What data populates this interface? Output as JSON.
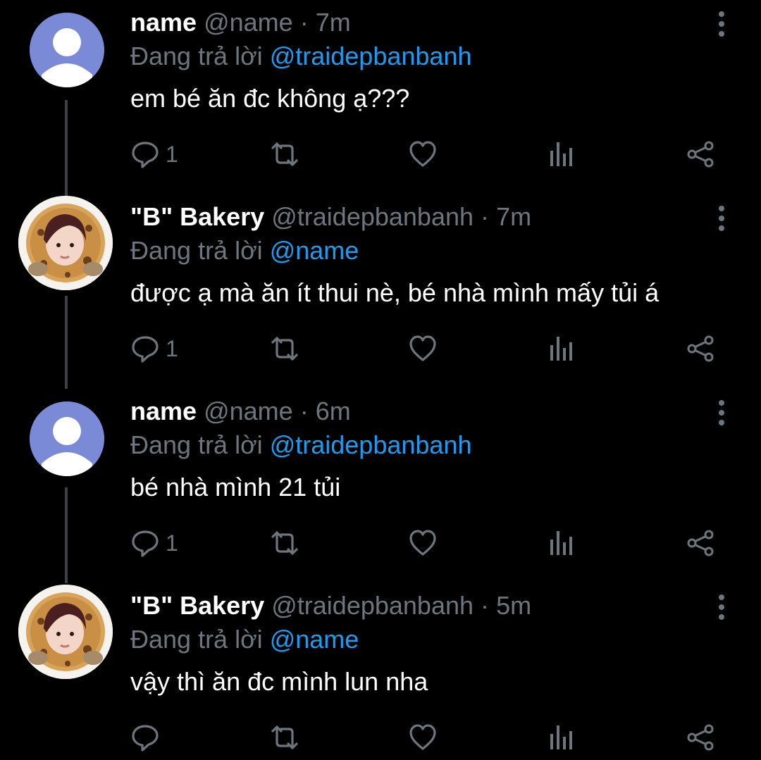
{
  "colors": {
    "background": "#000000",
    "name": "#ffffff",
    "muted": "#6e767d",
    "link": "#1d9bf0",
    "thread_line": "#3e4144"
  },
  "tweets": [
    {
      "avatar": "default-user-avatar",
      "display_name": "name",
      "handle": "@name",
      "dot": "·",
      "time": "7m",
      "replying_prefix": "Đang trả lời",
      "replying_to": "@traidepbanbanh",
      "text": "em bé ăn đc không ạ???",
      "reply_count": "1"
    },
    {
      "avatar": "cookie-avatar",
      "display_name": "\"B\" Bakery",
      "handle": "@traidepbanbanh",
      "dot": "·",
      "time": "7m",
      "replying_prefix": "Đang trả lời",
      "replying_to": "@name",
      "text": "được ạ mà ăn ít thui nè, bé nhà mình mấy tủi á",
      "reply_count": "1"
    },
    {
      "avatar": "default-user-avatar",
      "display_name": "name",
      "handle": "@name",
      "dot": "·",
      "time": "6m",
      "replying_prefix": "Đang trả lời",
      "replying_to": "@traidepbanbanh",
      "text": "bé nhà mình 21 tủi",
      "reply_count": "1"
    },
    {
      "avatar": "cookie-avatar",
      "display_name": "\"B\" Bakery",
      "handle": "@traidepbanbanh",
      "dot": "·",
      "time": "5m",
      "replying_prefix": "Đang trả lời",
      "replying_to": "@name",
      "text": "vậy thì ăn đc mình lun nha",
      "reply_count": ""
    }
  ]
}
